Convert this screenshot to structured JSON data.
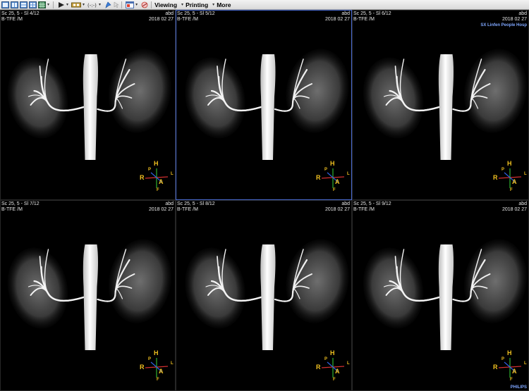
{
  "toolbar": {
    "icons": [
      "layout-1-icon",
      "layout-2-icon",
      "layout-3-icon",
      "layout-4-icon",
      "grid-icon",
      "play-icon",
      "film-icon",
      "link-icon",
      "pin-icon",
      "window-icon",
      "wand-icon"
    ],
    "viewing_label": "Viewing",
    "printing_label": "Printing",
    "more_label": "More"
  },
  "viewports": [
    {
      "series": "Sc 25, 5 - Sl 4/12",
      "seq": "B-TFE  /M",
      "region": "abd",
      "date": "2018 02 27",
      "hospital": "",
      "vendor": "",
      "active": false,
      "orient": {
        "h": "H",
        "p": "P",
        "r": "R",
        "l": "L",
        "a": "A",
        "f": "F"
      }
    },
    {
      "series": "Sc 25, 5 - Sl 5/12",
      "seq": "B-TFE  /M",
      "region": "abd",
      "date": "2018 02 27",
      "hospital": "",
      "vendor": "",
      "active": true,
      "orient": {
        "h": "H",
        "p": "P",
        "r": "R",
        "l": "L",
        "a": "A",
        "f": "F"
      }
    },
    {
      "series": "Sc 25, 5 - Sl 6/12",
      "seq": "B-TFE  /M",
      "region": "abd",
      "date": "2018 02 27",
      "hospital": "SX Linfen People Hosp",
      "vendor": "",
      "active": false,
      "orient": {
        "h": "H",
        "p": "P",
        "r": "R",
        "l": "L",
        "a": "A",
        "f": "F"
      }
    },
    {
      "series": "Sc 25, 5 - Sl 7/12",
      "seq": "B-TFE  /M",
      "region": "abd",
      "date": "2018 02 27",
      "hospital": "",
      "vendor": "",
      "active": false,
      "orient": {
        "h": "H",
        "p": "P",
        "r": "R",
        "l": "L",
        "a": "A",
        "f": "F"
      }
    },
    {
      "series": "Sc 25, 5 - Sl 8/12",
      "seq": "B-TFE  /M",
      "region": "abd",
      "date": "2018 02 27",
      "hospital": "",
      "vendor": "",
      "active": false,
      "orient": {
        "h": "H",
        "p": "P",
        "r": "R",
        "l": "L",
        "a": "A",
        "f": "F"
      }
    },
    {
      "series": "Sc 25, 5 - Sl 9/12",
      "seq": "B-TFE  /M",
      "region": "abd",
      "date": "2018 02 27",
      "hospital": "",
      "vendor": "PHILIPS",
      "active": false,
      "orient": {
        "h": "H",
        "p": "P",
        "r": "R",
        "l": "L",
        "a": "A",
        "f": "F"
      }
    }
  ]
}
